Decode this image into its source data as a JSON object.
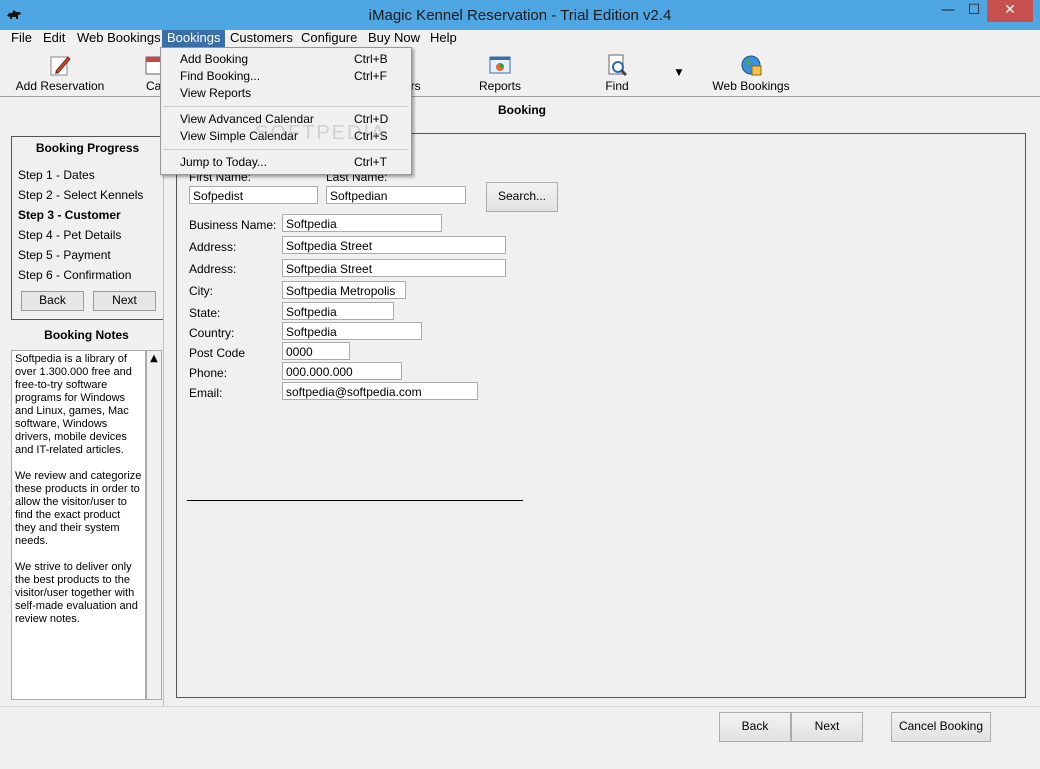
{
  "window": {
    "title": "iMagic Kennel Reservation - Trial Edition v2.4",
    "minimize": "—",
    "maximize": "☐",
    "close": "✕"
  },
  "menu": [
    "File",
    "Edit",
    "Web Bookings",
    "Bookings",
    "Customers",
    "Configure",
    "Buy Now",
    "Help"
  ],
  "toolbar": [
    {
      "label": "Add Reservation",
      "icon": "pencil-icon"
    },
    {
      "label": "Ca",
      "icon": "calendar-icon"
    },
    {
      "label": "mers",
      "icon": "customers-icon"
    },
    {
      "label": "Reports",
      "icon": "reports-icon"
    },
    {
      "label": "Find",
      "icon": "find-icon"
    },
    {
      "label": "Web Bookings",
      "icon": "globe-icon"
    }
  ],
  "toolbar_dropdown": "▼",
  "section_title": "Booking",
  "progress": {
    "title": "Booking Progress",
    "steps": [
      "Step 1 - Dates",
      "Step 2 - Select Kennels",
      "Step 3 - Customer",
      "Step 4 - Pet Details",
      "Step 5 - Payment",
      "Step 6 - Confirmation"
    ],
    "current_step": 3,
    "back": "Back",
    "next": "Next"
  },
  "notes": {
    "title": "Booking Notes",
    "text": "Softpedia is a library of over 1.300.000 free and free-to-try software programs for Windows and Linux, games, Mac software, Windows drivers, mobile devices and IT-related articles.\n\nWe review and categorize these products in order to allow the visitor/user to find the exact product they and their system needs.\n\nWe strive to deliver only the best products to the visitor/user together with self-made evaluation and review notes.",
    "scroll_up": "▲"
  },
  "form": {
    "first_name_label": "First Name:",
    "last_name_label": "Last Name:",
    "first_name": "Sofpedist",
    "last_name": "Softpedian",
    "search": "Search...",
    "fields": [
      {
        "label": "Business Name:",
        "value": "Softpedia"
      },
      {
        "label": "Address:",
        "value": "Softpedia Street"
      },
      {
        "label": "Address:",
        "value": "Softpedia Street"
      },
      {
        "label": "City:",
        "value": "Softpedia Metropolis"
      },
      {
        "label": "State:",
        "value": "Softpedia"
      },
      {
        "label": "Country:",
        "value": "Softpedia"
      },
      {
        "label": "Post Code",
        "value": "0000"
      },
      {
        "label": "Phone:",
        "value": "000.000.000"
      },
      {
        "label": "Email:",
        "value": "softpedia@softpedia.com"
      }
    ]
  },
  "footer": {
    "back": "Back",
    "next": "Next",
    "cancel": "Cancel Booking"
  },
  "bookings_menu": [
    {
      "label": "Add Booking",
      "shortcut": "Ctrl+B"
    },
    {
      "label": "Find Booking...",
      "shortcut": "Ctrl+F"
    },
    {
      "label": "View Reports",
      "shortcut": ""
    },
    {
      "label": "View Advanced Calendar",
      "shortcut": "Ctrl+D"
    },
    {
      "label": "View Simple Calendar",
      "shortcut": "Ctrl+S"
    },
    {
      "label": "Jump to Today...",
      "shortcut": "Ctrl+T"
    }
  ],
  "watermark": "SOFTPEDIA"
}
